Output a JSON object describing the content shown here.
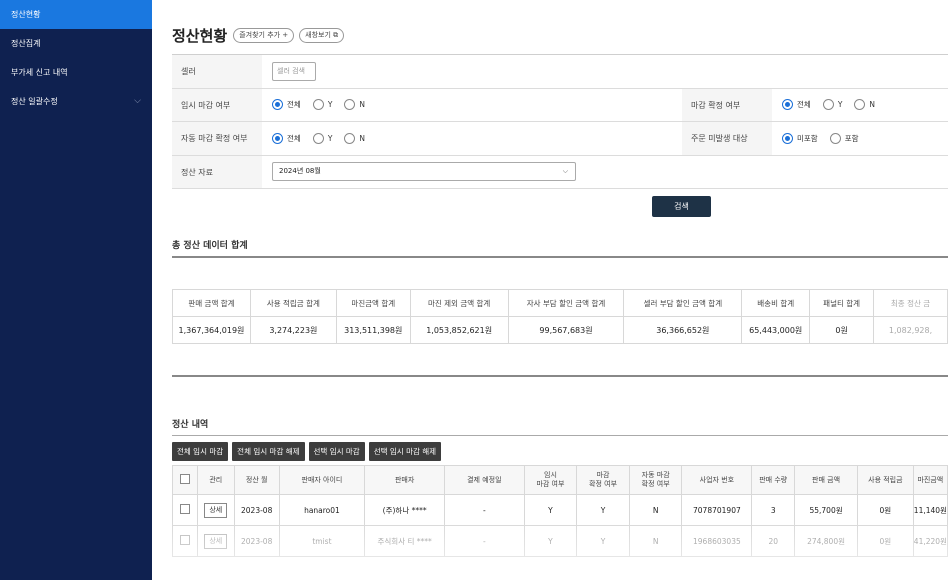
{
  "sidebar": {
    "items": [
      {
        "label": "정산현황"
      },
      {
        "label": "정산집계"
      },
      {
        "label": "부가세 신고 내역"
      },
      {
        "label": "정산 일괄수정"
      }
    ]
  },
  "header": {
    "title": "정산현황",
    "favorite_label": "즐겨찾기 추가 +",
    "new_window_label": "새창보기 ⧉"
  },
  "filter": {
    "seller_label": "셀러",
    "seller_placeholder": "셀러 검색",
    "temp_close_label": "임시 마감 여부",
    "temp_close_options": [
      "전체",
      "Y",
      "N"
    ],
    "close_confirm_label": "마감 확정 여부",
    "close_confirm_options": [
      "전체",
      "Y",
      "N"
    ],
    "auto_close_label": "자동 마감 확정 여부",
    "auto_close_options": [
      "전체",
      "Y",
      "N"
    ],
    "order_label": "주문 미발생 대상",
    "order_options": [
      "미포함",
      "포함"
    ],
    "data_label": "정산 자료",
    "data_value": "2024년 08월",
    "search_button": "검색"
  },
  "summary": {
    "title": "총 정산 데이터 합계",
    "headers": [
      "판매 금액 합계",
      "사용 적립금 합계",
      "마진금액 합계",
      "마진 제외 금액 합계",
      "자사 부담 할인 금액 합계",
      "셀러 부담 할인 금액 합계",
      "배송비 합계",
      "패널티 합계",
      "최종 정산 금"
    ],
    "values": [
      "1,367,364,019원",
      "3,274,223원",
      "313,511,398원",
      "1,053,852,621원",
      "99,567,683원",
      "36,366,652원",
      "65,443,000원",
      "0원",
      "1,082,928,"
    ]
  },
  "list": {
    "title": "정산 내역",
    "buttons": [
      "전체 임시 마감",
      "전체 임시 마감 해제",
      "선택 임시 마감",
      "선택 임시 마감 해제"
    ],
    "headers": [
      "관리",
      "정산 월",
      "판매자 아이디",
      "판매자",
      "결제 예정일",
      "임시\n마감 여부",
      "마감\n확정 여부",
      "자동 마감\n확정 여부",
      "사업자 번호",
      "판매 수량",
      "판매 금액",
      "사용 적립금",
      "마진금액"
    ],
    "rows": [
      [
        "상세",
        "2023-08",
        "hanaro01",
        "(주)하나 ****",
        "-",
        "Y",
        "Y",
        "N",
        "7078701907",
        "3",
        "55,700원",
        "0원",
        "11,140원"
      ],
      [
        "상세",
        "2023-08",
        "tmist",
        "주식회사 티 ****",
        "-",
        "Y",
        "Y",
        "N",
        "1968603035",
        "20",
        "274,800원",
        "0원",
        "41,220원"
      ]
    ]
  }
}
